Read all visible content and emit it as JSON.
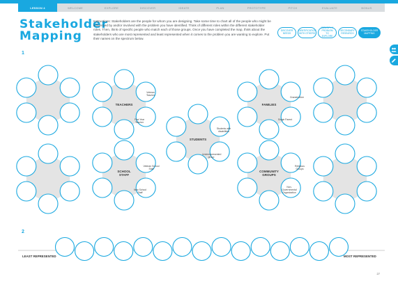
{
  "nav": {
    "tabs": [
      "Lesson 4",
      "Welcome",
      "Explore",
      "Discover",
      "Ideate",
      "Plan",
      "Prototype",
      "Pitch",
      "Evaluate",
      "Bonus"
    ],
    "active_index": 0
  },
  "header": {
    "title_line1": "Stakeholder",
    "title_line2": "Mapping",
    "instructions": "Instructions: Stakeholders are the people for whom you are designing. Take some time to chart all of the people who might be influenced by and/or involved with the problem you have identified. Think of different roles within the different stakeholder roles. Then, think of specific people who match each of those groups. Once you have completed the map, think about the stakeholders who are most represented and least represented when it comes to the problem you are wanting to explore. Put their names on the spectrum below.",
    "pills": [
      "Discover Needs",
      "Identification with Others",
      "Identify a Problem to Explore",
      "Secondary Research",
      "Stakeholder Mapping"
    ],
    "active_pill": 4
  },
  "sidebar": {
    "icons": [
      "people-icon",
      "pencil-icon"
    ]
  },
  "section1": {
    "number": "1",
    "clusters": {
      "teachers": {
        "label": "TEACHERS",
        "subs": [
          "Veteran Teacher",
          "First Year Teacher"
        ]
      },
      "families": {
        "label": "FAMILIES",
        "subs": [
          "Grandmother",
          "Single Parent"
        ]
      },
      "students": {
        "label": "STUDENTS",
        "subs": [
          "Students with disabilities",
          "Underrepresented group"
        ]
      },
      "school_staff": {
        "label_line1": "SCHOOL",
        "label_line2": "STAFF",
        "subs": [
          "Veteran School Staff",
          "New School Staff"
        ]
      },
      "community": {
        "label_line1": "COMMUNITY",
        "label_line2": "GROUPS",
        "subs": [
          "Religious Groups",
          "Non-Governmental Organization"
        ]
      }
    }
  },
  "section2": {
    "number": "2",
    "least_label": "LEAST REPRESENTED",
    "most_label": "MOST REPRESENTED"
  },
  "page_number": "27",
  "colors": {
    "accent": "#19a8e0",
    "hub": "#e4e4e4",
    "strip": "#d9dde0"
  }
}
